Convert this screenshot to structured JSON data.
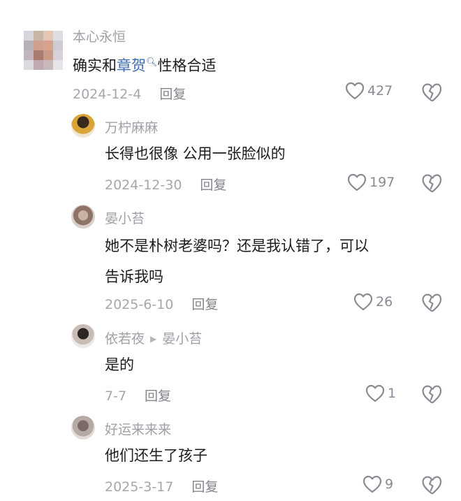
{
  "comments": [
    {
      "username": "本心永恒",
      "text_before": "确实和",
      "link": "章贺",
      "text_after": "性格合适",
      "date": "2024-12-4",
      "reply_label": "回复",
      "likes": "427"
    },
    {
      "username": "万柠麻麻",
      "text": "长得也很像 公用一张脸似的",
      "date": "2024-12-30",
      "reply_label": "回复",
      "likes": "197"
    },
    {
      "username": "晏小苔",
      "text_line1": "她不是朴树老婆吗？还是我认错了，可以",
      "text_line2": "告诉我吗",
      "date": "2025-6-10",
      "reply_label": "回复",
      "likes": "26"
    },
    {
      "username": "依若夜",
      "reply_to": "晏小苔",
      "text": "是的",
      "date": "7-7",
      "reply_label": "回复",
      "likes": "1"
    },
    {
      "username": "好运来来来",
      "text": "他们还生了孩子",
      "date": "2025-3-17",
      "reply_label": "回复",
      "likes": "9"
    }
  ],
  "icons": {
    "like": "heart-outline-icon",
    "dislike": "broken-heart-icon",
    "search": "search-icon"
  },
  "colors": {
    "text": "#1c1c1e",
    "meta": "#a6a6ad",
    "link": "#3d6ab5"
  }
}
